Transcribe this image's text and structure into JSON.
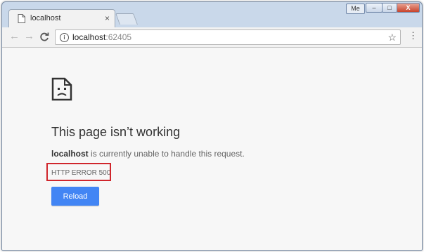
{
  "window": {
    "user_badge": "Me",
    "minimize": "–",
    "maximize": "□",
    "close": "X"
  },
  "tab": {
    "title": "localhost",
    "close": "×"
  },
  "toolbar": {
    "back": "←",
    "forward": "→",
    "reload": "C",
    "info": "i",
    "url_host": "localhost",
    "url_port": ":62405",
    "star": "☆",
    "menu": "⋮"
  },
  "error_page": {
    "heading": "This page isn’t working",
    "host": "localhost",
    "message_rest": " is currently unable to handle this request.",
    "error_code": "HTTP ERROR 500",
    "reload_button": "Reload",
    "highlight_color": "#d0262c",
    "button_color": "#4285f4"
  }
}
